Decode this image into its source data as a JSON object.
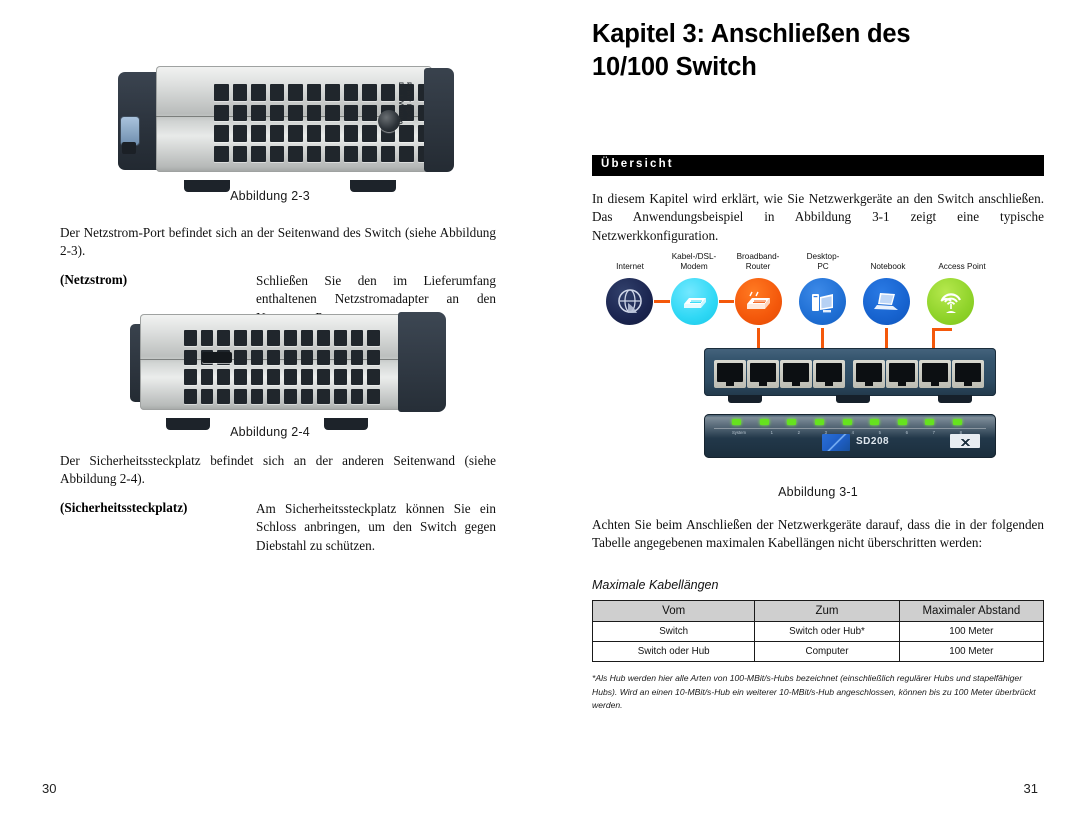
{
  "left_page": {
    "folio": "30",
    "figure_2_3": {
      "caption": "Abbildung 2-3",
      "device_label_line1": "Power Input",
      "device_label_line2": "DC 12V/800mA"
    },
    "paragraph_power": "Der Netzstrom-Port befindet sich an der Seitenwand des Switch (siehe Abbildung 2-3).",
    "definition_power": {
      "term": "(Netzstrom)",
      "body": "Schließen Sie den im Lieferumfang enthaltenen Netzstromadapter an den Netzstrom-Port an."
    },
    "figure_2_4": {
      "caption": "Abbildung 2-4"
    },
    "paragraph_security": "Der Sicherheitssteckplatz befindet sich an der anderen Seitenwand (siehe Abbildung 2-4).",
    "definition_security": {
      "term": "(Sicherheitssteckplatz)",
      "body": "Am Sicherheitssteckplatz können Sie ein Schloss anbringen, um den Switch gegen Diebstahl zu schützen."
    }
  },
  "right_page": {
    "folio": "31",
    "chapter_title_line1": "Kapitel 3: Anschließen des",
    "chapter_title_line2": "10/100 Switch",
    "section_band_label": "Übersicht",
    "overview_paragraph": "In diesem Kapitel wird erklärt, wie Sie Netzwerkgeräte an den Switch anschließen. Das Anwendungsbeispiel in Abbildung 3-1 zeigt eine typische Netzwerkkonfiguration.",
    "diagram": {
      "caption": "Abbildung 3-1",
      "nodes": [
        {
          "label_line1": "Internet",
          "label_line2": "",
          "icon": "internet-globe-icon",
          "color": "#1b2550"
        },
        {
          "label_line1": "Kabel-/DSL-",
          "label_line2": "Modem",
          "icon": "modem-icon",
          "color": "#2fd8f5"
        },
        {
          "label_line1": "Broadband-",
          "label_line2": "Router",
          "icon": "router-icon",
          "color": "#f4580b"
        },
        {
          "label_line1": "Desktop-",
          "label_line2": "PC",
          "icon": "desktop-pc-icon",
          "color": "#1f6fd4"
        },
        {
          "label_line1": "Notebook",
          "label_line2": "",
          "icon": "notebook-icon",
          "color": "#1763cf"
        },
        {
          "label_line1": "Access Point",
          "label_line2": "",
          "icon": "access-point-icon",
          "color": "#8fd32a"
        }
      ],
      "switch_model": "SD208",
      "switch_led_labels": [
        "System",
        "1",
        "2",
        "3",
        "4",
        "5",
        "6",
        "7",
        "8"
      ],
      "port_count": 8,
      "link_color": "#f4580b"
    },
    "cable_paragraph": "Achten Sie beim Anschließen der Netzwerkgeräte darauf, dass die in der folgenden Tabelle angegebenen maximalen Kabellängen nicht überschritten werden:",
    "table": {
      "title": "Maximale Kabellängen",
      "headers": [
        "Vom",
        "Zum",
        "Maximaler Abstand"
      ],
      "rows": [
        [
          "Switch",
          "Switch oder Hub*",
          "100 Meter"
        ],
        [
          "Switch oder Hub",
          "Computer",
          "100 Meter"
        ]
      ]
    },
    "footnote": "*Als Hub werden hier alle Arten von 100-MBit/s-Hubs bezeichnet (einschließlich regulärer Hubs und stapelfähiger Hubs). Wird an einen 10-MBit/s-Hub ein weiterer 10-MBit/s-Hub angeschlossen, können bis zu 100 Meter überbrückt werden."
  }
}
